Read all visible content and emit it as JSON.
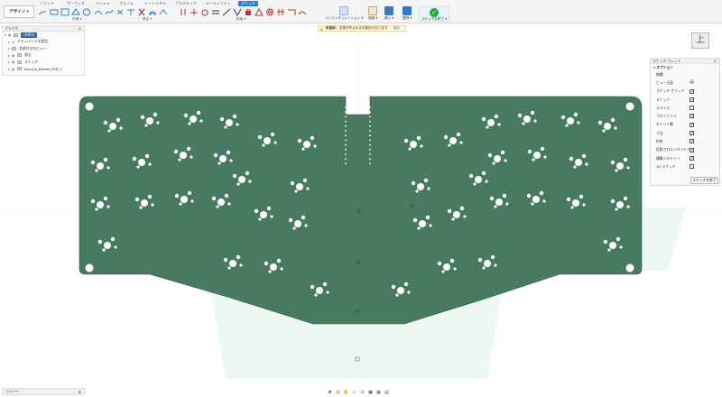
{
  "ribbon": {
    "tabs": [
      "ソリッド",
      "サーフェス",
      "メッシュ",
      "フォーム",
      "シートメタル",
      "プラスチック",
      "ユーティリティ",
      "スケッチ"
    ],
    "active_tab": "スケッチ",
    "design_button": "デザイン ▾",
    "group_labels": {
      "create": "作成 ▾",
      "modify": "修正 ▾",
      "constraints": "拘束 ▾"
    },
    "configure": "コンフィギュレーション ▾",
    "inspect": "検査 ▾",
    "insert": "挿入 ▾",
    "select": "選択 ▾",
    "finish": "スケッチを終了 ▾"
  },
  "browser": {
    "title": "ブラウザ",
    "close": "×",
    "items": [
      {
        "label": "(未保存)",
        "chip": true
      },
      {
        "label": "ドキュメントの設定"
      },
      {
        "label": "名前付きのビュー"
      },
      {
        "label": "原点"
      },
      {
        "label": "スケッチ"
      },
      {
        "label": "Akucho_Middle_PCB 1"
      }
    ]
  },
  "warning": {
    "label": "未保存:",
    "text": "変更が失われる可能性があります",
    "link": "保存"
  },
  "viewcube": {
    "face": "上"
  },
  "sketch_palette": {
    "title": "スケッチ パレット",
    "close": "×",
    "options_header": "▾ オプション",
    "rows": [
      {
        "label": "線種",
        "state": "none"
      },
      {
        "label": "ビュー正面",
        "state": "icon"
      },
      {
        "label": "スケッチ グリッド",
        "state": "checked"
      },
      {
        "label": "スナップ",
        "state": "checked"
      },
      {
        "label": "スライス",
        "state": "unchecked"
      },
      {
        "label": "プロファイル",
        "state": "checked"
      },
      {
        "label": "ポイント数",
        "state": "checked"
      },
      {
        "label": "寸法",
        "state": "checked"
      },
      {
        "label": "拘束",
        "state": "checked"
      },
      {
        "label": "投影されたジオメトリ",
        "state": "checked"
      },
      {
        "label": "構築ジオメトリ",
        "state": "checked"
      },
      {
        "label": "3D スケッチ",
        "state": "unchecked"
      }
    ],
    "finish_button": "スケッチを終了"
  },
  "comments": {
    "label": "コメント",
    "toggle": "⊞"
  },
  "colors": {
    "board": "#477a60",
    "accent": "#2a7bd3",
    "finish_check": "#25a83a"
  }
}
